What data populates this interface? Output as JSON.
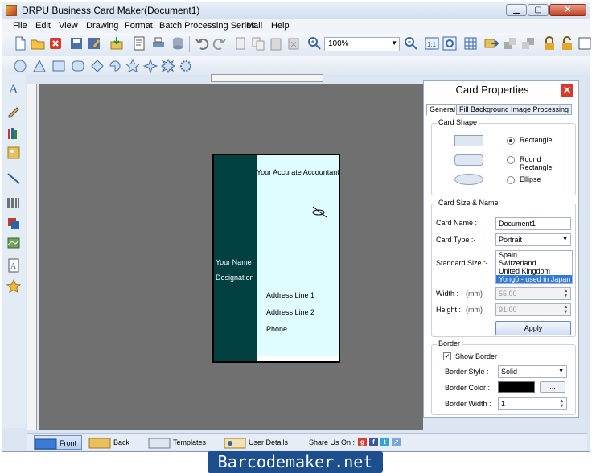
{
  "window": {
    "title": "DRPU Business Card Maker(Document1)"
  },
  "menu": [
    "File",
    "Edit",
    "View",
    "Drawing",
    "Format",
    "Batch Processing Series",
    "Mail",
    "Help"
  ],
  "toolbar": {
    "zoom": "100%"
  },
  "card": {
    "tagline": "Your Accurate Accountant",
    "name": "Your Name",
    "designation": "Designation",
    "address1": "Address Line 1",
    "address2": "Address Line 2",
    "phone": "Phone",
    "band_color": "#014040",
    "bg_color": "#dffcff"
  },
  "panel": {
    "title": "Card Properties",
    "tabs": [
      "General",
      "Fill Background",
      "Image Processing"
    ],
    "card_shape": {
      "label": "Card Shape",
      "options": [
        "Rectangle",
        "Round Rectangle",
        "Ellipse"
      ],
      "selected": "Rectangle"
    },
    "size_name": {
      "label": "Card Size & Name",
      "card_name_label": "Card Name :",
      "card_name": "Document1",
      "card_type_label": "Card Type :-",
      "card_type": "Portrait",
      "standard_size_label": "Standard Size :-",
      "sizes": [
        "Spain",
        "Switzerland",
        "United Kingdom",
        "Yongō - used in Japan"
      ],
      "selected_size": "Yongō - used in Japan",
      "width_label": "Width :",
      "width_unit": "(mm)",
      "width": "55.00",
      "height_label": "Height :",
      "height_unit": "(mm)",
      "height": "91.00",
      "apply": "Apply"
    },
    "border": {
      "label": "Border",
      "show_border": "Show Border",
      "show_border_checked": true,
      "style_label": "Border Style :",
      "style": "Solid",
      "color_label": "Border Color :",
      "color": "#000000",
      "color_button": "...",
      "width_label": "Border Width :",
      "width": "1"
    }
  },
  "status": {
    "front": "Front",
    "back": "Back",
    "templates": "Templates",
    "user_details": "User Details",
    "share": "Share Us On :"
  },
  "brand": "Barcodemaker.net"
}
